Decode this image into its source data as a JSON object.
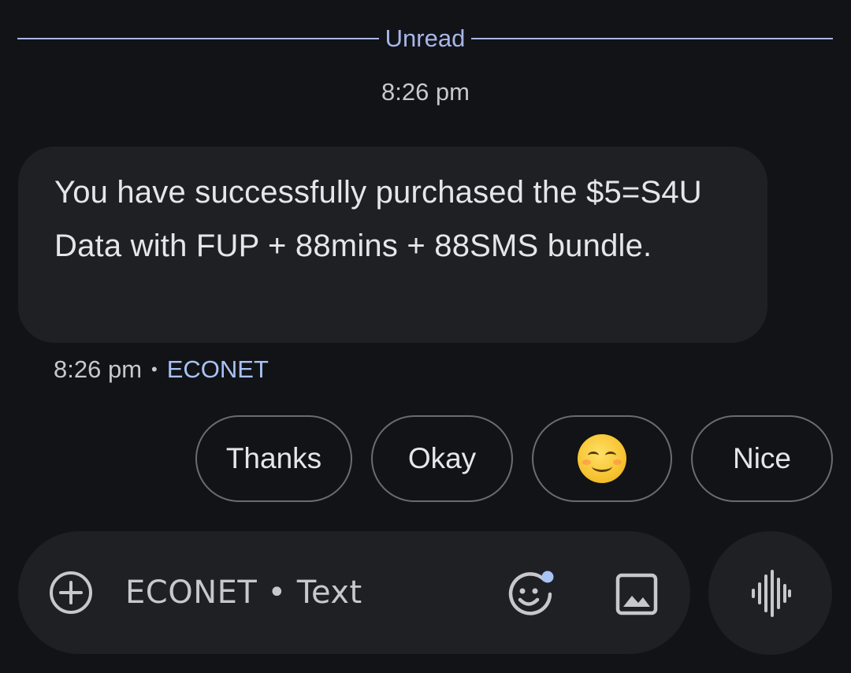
{
  "divider": {
    "label": "Unread"
  },
  "conversation": {
    "top_timestamp": "8:26 pm",
    "message": {
      "text": "You have successfully purchased the $5=S4U Data with FUP + 88mins + 88SMS bundle.",
      "time": "8:26 pm",
      "separator": "•",
      "sender": "ECONET"
    }
  },
  "smart_replies": [
    {
      "label": "Thanks"
    },
    {
      "label": "Okay"
    },
    {
      "label": "",
      "icon": "smiling-face-emoji"
    },
    {
      "label": "Nice"
    }
  ],
  "compose": {
    "placeholder": "ECONET • Text",
    "icons": [
      "add-icon",
      "emoji-icon",
      "image-icon",
      "voice-icon"
    ]
  },
  "colors": {
    "background": "#121317",
    "bubble": "#1f2024",
    "accent": "#a8c3f4",
    "badge_dot": "#a8c3f4"
  }
}
